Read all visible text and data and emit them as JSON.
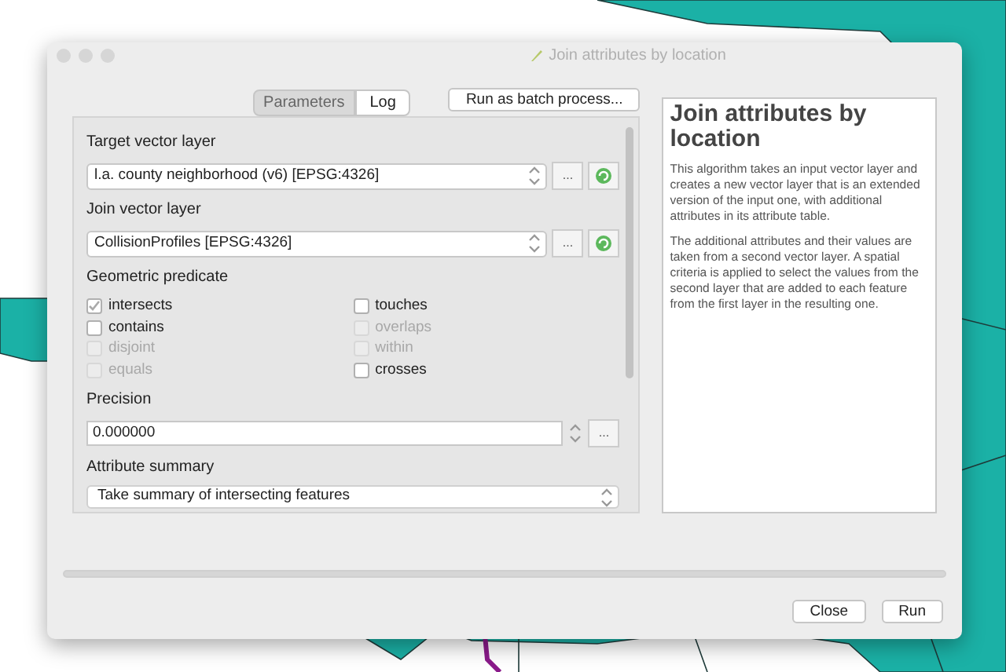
{
  "window": {
    "title": "Join attributes by location"
  },
  "tabs": [
    {
      "label": "Parameters",
      "selected": true
    },
    {
      "label": "Log",
      "selected": false
    }
  ],
  "batch_button": "Run as batch process...",
  "target_layer": {
    "label": "Target vector layer",
    "value": "l.a. county neighborhood (v6) [EPSG:4326]",
    "browse": "..."
  },
  "join_layer": {
    "label": "Join vector layer",
    "value": "CollisionProfiles [EPSG:4326]",
    "browse": "..."
  },
  "predicate": {
    "label": "Geometric predicate",
    "options": [
      {
        "label": "intersects",
        "checked": true,
        "disabled": false
      },
      {
        "label": "touches",
        "checked": false,
        "disabled": false
      },
      {
        "label": "contains",
        "checked": false,
        "disabled": false
      },
      {
        "label": "overlaps",
        "checked": false,
        "disabled": true
      },
      {
        "label": "disjoint",
        "checked": false,
        "disabled": true
      },
      {
        "label": "within",
        "checked": false,
        "disabled": true
      },
      {
        "label": "equals",
        "checked": false,
        "disabled": true
      },
      {
        "label": "crosses",
        "checked": false,
        "disabled": false
      }
    ]
  },
  "precision": {
    "label": "Precision",
    "value": "0.000000",
    "browse": "..."
  },
  "summary": {
    "label": "Attribute summary",
    "value": "Take summary of intersecting features"
  },
  "help": {
    "title": "Join attributes by location",
    "paragraphs": [
      "This algorithm takes an input vector layer and creates a new vector layer that is an extended version of the input one, with additional attributes in its attribute table.",
      "The additional attributes and their values are taken from a second vector layer. A spatial criteria is applied to select the values from the second layer that are added to each feature from the first layer in the resulting one."
    ]
  },
  "progress": {
    "level": 0
  },
  "buttons": [
    "Close",
    "Run"
  ]
}
